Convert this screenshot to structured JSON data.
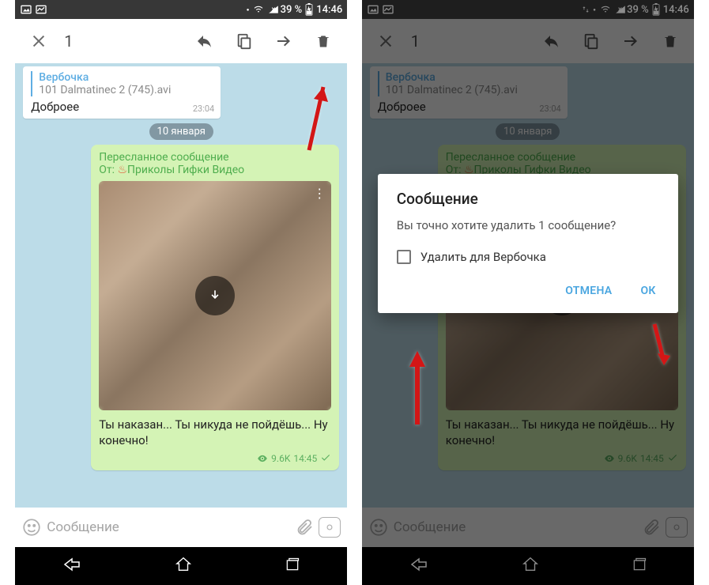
{
  "status": {
    "battery": "39 %",
    "time": "14:46"
  },
  "toolbar": {
    "count": "1"
  },
  "reply": {
    "name": "Вербочка",
    "file": "101 Dalmatinec 2 (745).avi",
    "text": "Доброее",
    "time": "23:04"
  },
  "date": "10 января",
  "fwd": {
    "title": "Пересланное сообщение",
    "from_prefix": "От: ",
    "from_name": "Приколы Гифки Видео",
    "hot_emoji": "♨",
    "caption": "Ты наказан... Ты никуда не пойдёшь... Ну конечно!",
    "views": "9.6K",
    "time": "14:45"
  },
  "input": {
    "placeholder": "Сообщение"
  },
  "dialog": {
    "title": "Сообщение",
    "body": "Вы точно хотите удалить 1 сообщение?",
    "checkbox": "Удалить для Вербочка",
    "cancel": "ОТМЕНА",
    "ok": "ОК"
  }
}
